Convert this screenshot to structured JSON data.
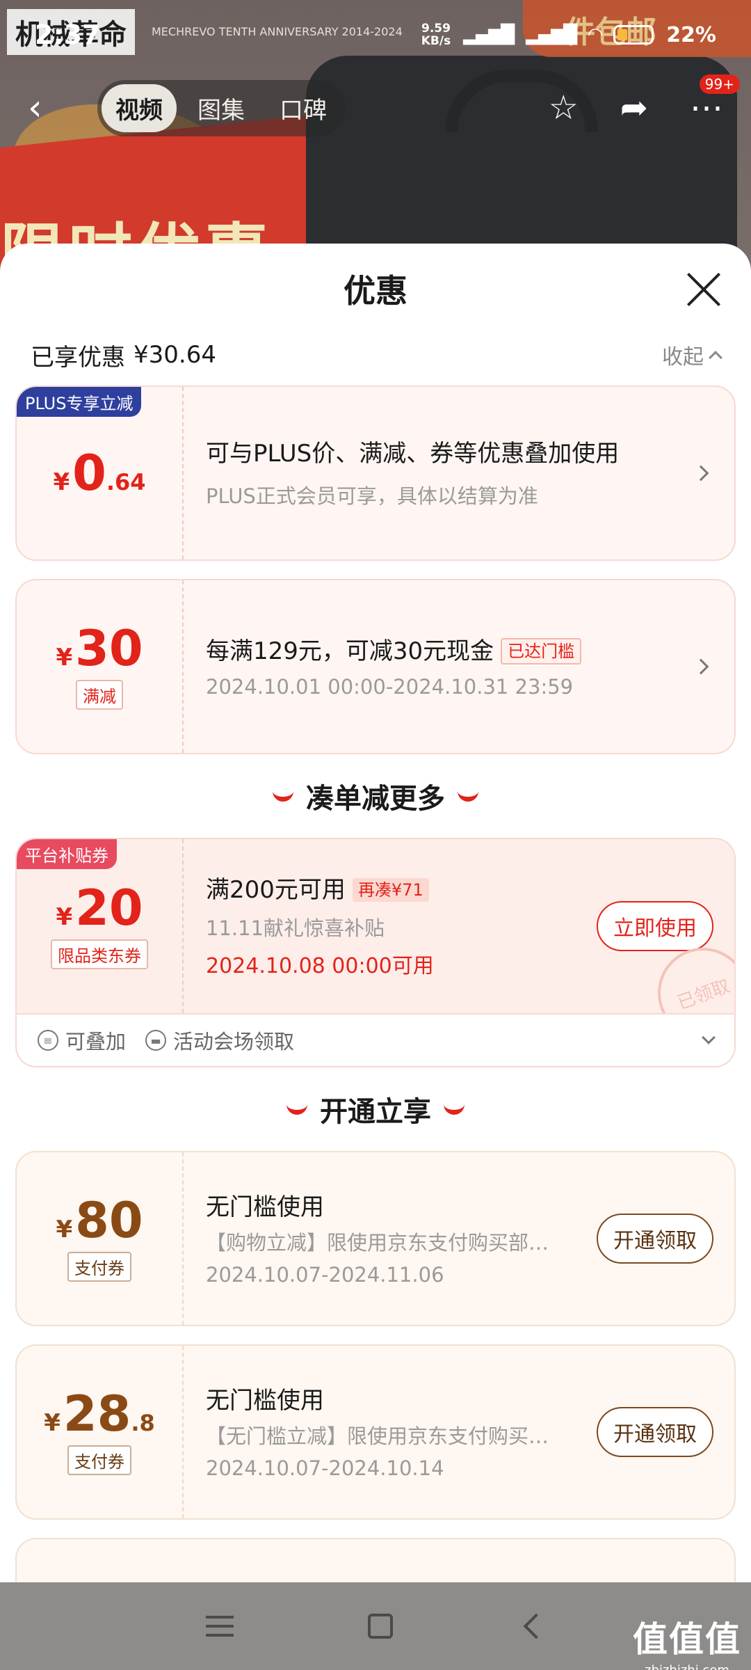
{
  "status_bar": {
    "time": "2:37",
    "speed_value": "9.59",
    "speed_unit": "KB/s",
    "battery_pct": "22%",
    "battery_level": 0.22
  },
  "background": {
    "brand": "机械革命",
    "brand_en": "MECHREVO",
    "anniversary": "MECHREVO TENTH ANNIVERSARY 2014-2024",
    "promo_text": "限时优惠",
    "banner_right": "件包邮"
  },
  "product_nav": {
    "tabs": [
      "视频",
      "图集",
      "口碑"
    ],
    "active_tab": 0,
    "cart_badge": "99+"
  },
  "sheet": {
    "title": "优惠",
    "saved_label": "已享优惠",
    "saved_amount": "¥30.64",
    "collapse_label": "收起"
  },
  "coupons_applied": [
    {
      "corner": "PLUS专享立减",
      "currency": "¥",
      "amount": "0",
      "decimal": ".64",
      "title": "可与PLUS价、满减、券等优惠叠加使用",
      "subtitle": "PLUS正式会员可享，具体以结算为准"
    },
    {
      "currency": "¥",
      "amount": "30",
      "tag": "满减",
      "title": "每满129元，可减30元现金",
      "title_pill": "已达门槛",
      "date": "2024.10.01 00:00-2024.10.31 23:59"
    }
  ],
  "section_more": {
    "title": "凑单减更多"
  },
  "platform_coupon": {
    "corner": "平台补贴券",
    "currency": "¥",
    "amount": "20",
    "tag": "限品类东券",
    "title": "满200元可用",
    "title_pill": "再凑¥71",
    "subtitle": "11.11献礼惊喜补贴",
    "date": "2024.10.08 00:00可用",
    "button": "立即使用",
    "stamp": "已领取",
    "footer_stackable": "可叠加",
    "footer_source": "活动会场领取"
  },
  "section_open": {
    "title": "开通立享"
  },
  "pay_coupons": [
    {
      "currency": "¥",
      "amount": "80",
      "decimal": "",
      "tag": "支付券",
      "title": "无门槛使用",
      "subtitle": "【购物立减】限使用京东支付购买部…",
      "date": "2024.10.07-2024.11.06",
      "button": "开通领取"
    },
    {
      "currency": "¥",
      "amount": "28",
      "decimal": ".8",
      "tag": "支付券",
      "title": "无门槛使用",
      "subtitle": "【无门槛立减】限使用京东支付购买…",
      "date": "2024.10.07-2024.10.14",
      "button": "开通领取"
    }
  ],
  "watermark": {
    "cn": "值值值",
    "url": "zhizhizhi.com"
  },
  "colors": {
    "accent_red": "#e2231a",
    "plus_blue": "#2f3f9e",
    "gold_brown": "#8a4a16"
  }
}
